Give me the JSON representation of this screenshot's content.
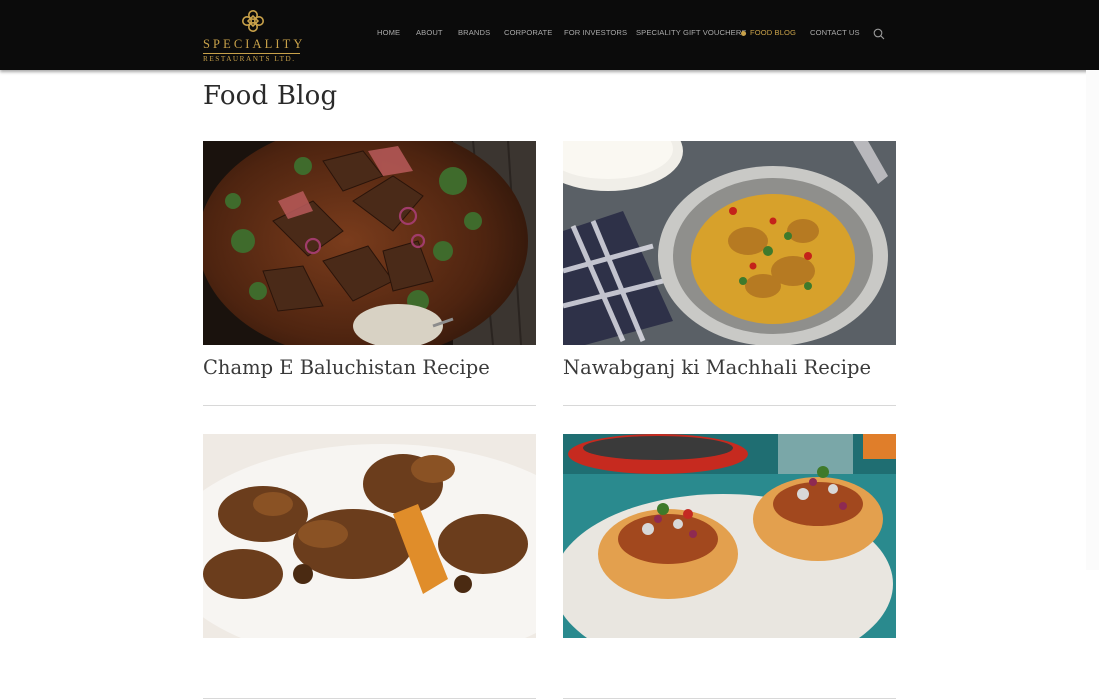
{
  "brand": {
    "line1": "SPECIALITY",
    "line2": "RESTAURANTS LTD."
  },
  "nav": [
    {
      "label": "HOME"
    },
    {
      "label": "ABOUT"
    },
    {
      "label": "BRANDS"
    },
    {
      "label": "CORPORATE"
    },
    {
      "label": "FOR INVESTORS"
    },
    {
      "label": "SPECIALITY GIFT VOUCHERS"
    },
    {
      "label": "FOOD BLOG",
      "active": true
    },
    {
      "label": "CONTACT US"
    }
  ],
  "icons": {
    "search": "search-icon",
    "logo": "speciality-emblem-icon"
  },
  "colors": {
    "topbar": "#0b0b0b",
    "accent": "#c9a24a",
    "nav_text": "#a9a9a9"
  },
  "page": {
    "title": "Food Blog"
  },
  "posts": [
    {
      "title": "Champ E Baluchistan Recipe",
      "image": "grilled lamb chops with herbs and onions on wooden board"
    },
    {
      "title": "Nawabganj ki Machhali Recipe",
      "image": "fish curry in grey bowl with rice"
    },
    {
      "title": "",
      "image": "braised meat curry with potatoes"
    },
    {
      "title": "",
      "image": "curry filled bread rolls on teal table"
    }
  ]
}
